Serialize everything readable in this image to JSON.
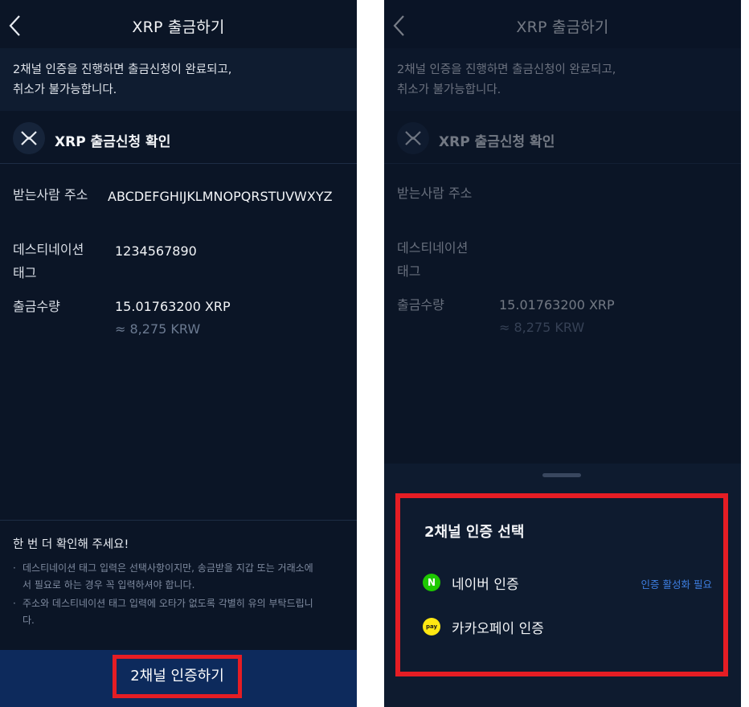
{
  "colors": {
    "background": "#0b1526",
    "notice_bg": "#0f1c30",
    "button_bg": "#0d2a5c",
    "highlight": "#e51d24",
    "naver_green": "#1ec800",
    "kakao_yellow": "#ffe812",
    "link_blue": "#3d7ee0"
  },
  "left": {
    "header": {
      "title": "XRP 출금하기",
      "back_icon": "chevron-left-icon"
    },
    "notice": {
      "line1": "2채널 인증을 진행하면 출금신청이 완료되고,",
      "line2": "취소가 불가능합니다."
    },
    "coin": {
      "icon": "xrp-icon",
      "title": "XRP 출금신청 확인"
    },
    "rows": {
      "address_label": "받는사람 주소",
      "address_value": "ABCDEFGHIJKLMNOPQRSTUVWXYZ",
      "tag_label_1": "데스티네이션",
      "tag_label_2": "태그",
      "tag_value": "1234567890",
      "amount_label": "출금수량",
      "amount_value": "15.01763200 XRP",
      "amount_krw": "≈ 8,275 KRW"
    },
    "check": {
      "title": "한 번 더 확인해 주세요!",
      "item1_a": "데스티네이션 태그 입력은 선택사항이지만, 송금받을 지갑 또는 거래소에",
      "item1_b": "서 필요로 하는 경우 꼭 입력하셔야 합니다.",
      "item2_a": "주소와 데스티네이션 태그 입력에 오타가 없도록 각별히 유의 부탁드립니",
      "item2_b": "다.",
      "bullet": "·"
    },
    "button": {
      "label": "2채널 인증하기"
    }
  },
  "right": {
    "header": {
      "title": "XRP 출금하기",
      "back_icon": "chevron-left-icon"
    },
    "notice": {
      "line1": "2채널 인증을 진행하면 출금신청이 완료되고,",
      "line2": "취소가 불가능합니다."
    },
    "coin": {
      "icon": "xrp-icon",
      "title": "XRP 출금신청 확인"
    },
    "rows": {
      "address_label": "받는사람 주소",
      "tag_label_1": "데스티네이션",
      "tag_label_2": "태그",
      "amount_label": "출금수량",
      "amount_value": "15.01763200 XRP",
      "amount_krw": "≈ 8,275 KRW"
    },
    "sheet": {
      "title": "2채널 인증 선택",
      "options": [
        {
          "icon": "naver-icon",
          "icon_text": "N",
          "label": "네이버 인증",
          "status": "인증 활성화 필요"
        },
        {
          "icon": "kakaopay-icon",
          "icon_text": "pay",
          "label": "카카오페이 인증",
          "status": ""
        }
      ]
    }
  }
}
